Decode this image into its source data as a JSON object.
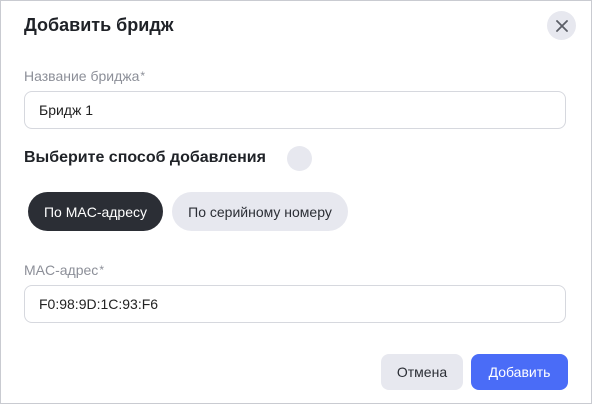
{
  "dialog": {
    "title": "Добавить бридж"
  },
  "bridge_name": {
    "label": "Название бриджа",
    "required_mark": "*",
    "value": "Бридж 1"
  },
  "method": {
    "title": "Выберите способ добавления",
    "options": [
      {
        "label": "По MAC-адресу",
        "selected": true
      },
      {
        "label": "По серийному номеру",
        "selected": false
      }
    ]
  },
  "mac_address": {
    "label": "MAC-адрес",
    "required_mark": "*",
    "value": "F0:98:9D:1C:93:F6"
  },
  "actions": {
    "cancel_label": "Отмена",
    "add_label": "Добавить"
  },
  "colors": {
    "primary": "#4a6cf7",
    "selected_segment": "#2b2e35",
    "neutral_button": "#e7e8ef"
  },
  "icons": {
    "close": "close-icon",
    "info": "info-icon"
  }
}
